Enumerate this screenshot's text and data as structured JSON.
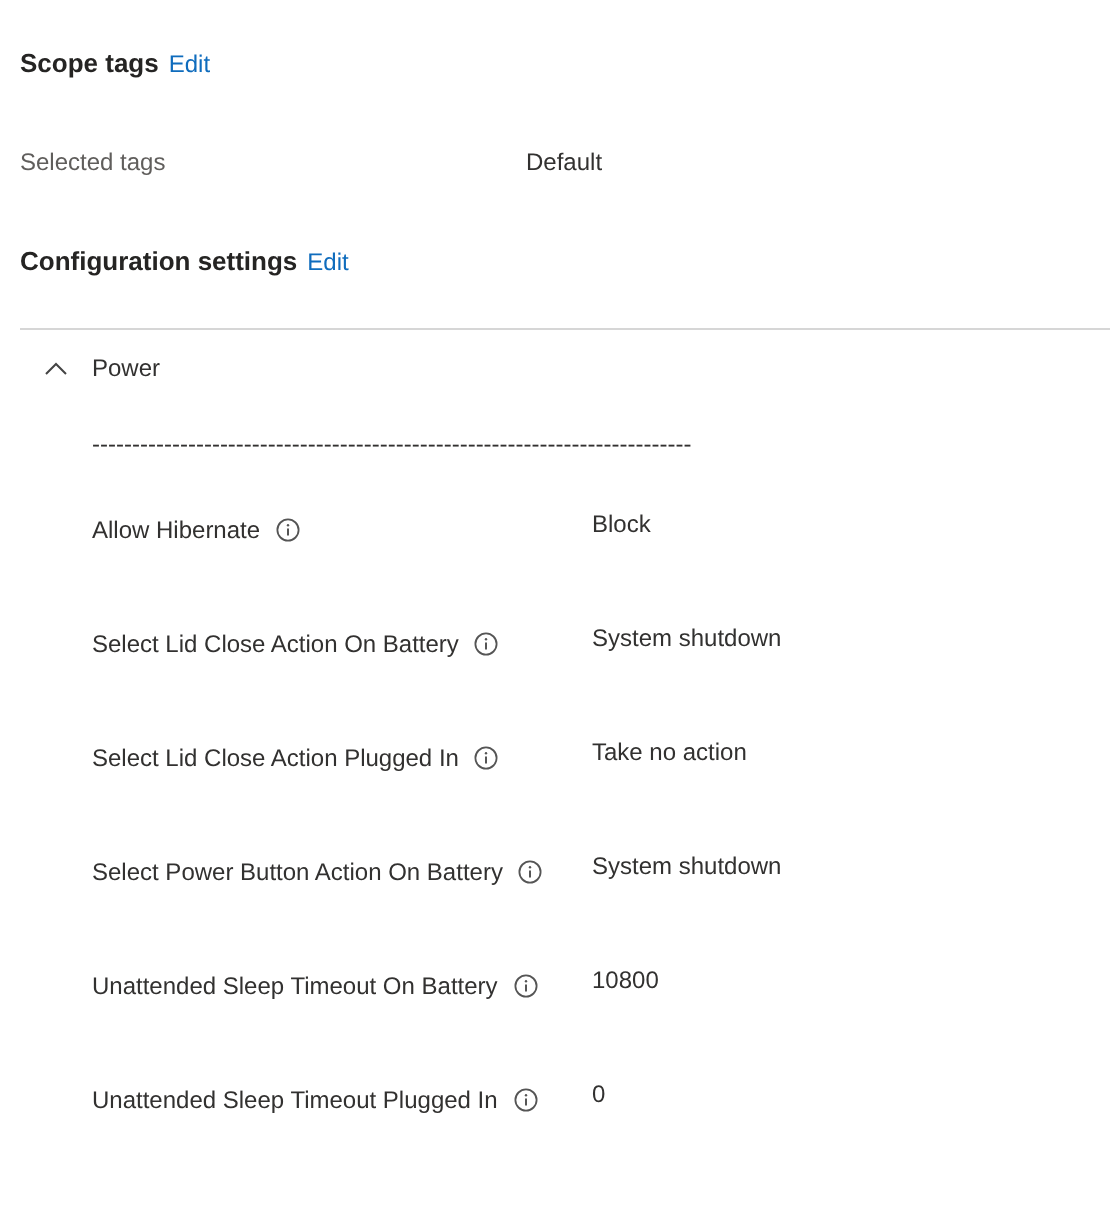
{
  "scope_tags": {
    "title": "Scope tags",
    "edit_link": "Edit",
    "fields": [
      {
        "label": "Selected tags",
        "value": "Default"
      }
    ]
  },
  "configuration_settings": {
    "title": "Configuration settings",
    "edit_link": "Edit",
    "section": {
      "title": "Power",
      "expanded": true,
      "separator": "---------------------------------------------------------------------------",
      "settings": [
        {
          "label": "Allow Hibernate",
          "value": "Block"
        },
        {
          "label": "Select Lid Close Action On Battery",
          "value": "System shutdown"
        },
        {
          "label": "Select Lid Close Action Plugged In",
          "value": "Take no action"
        },
        {
          "label": "Select Power Button Action On Battery",
          "value": "System shutdown"
        },
        {
          "label": "Unattended Sleep Timeout On Battery",
          "value": "10800"
        },
        {
          "label": "Unattended Sleep Timeout Plugged In",
          "value": "0"
        }
      ]
    }
  }
}
